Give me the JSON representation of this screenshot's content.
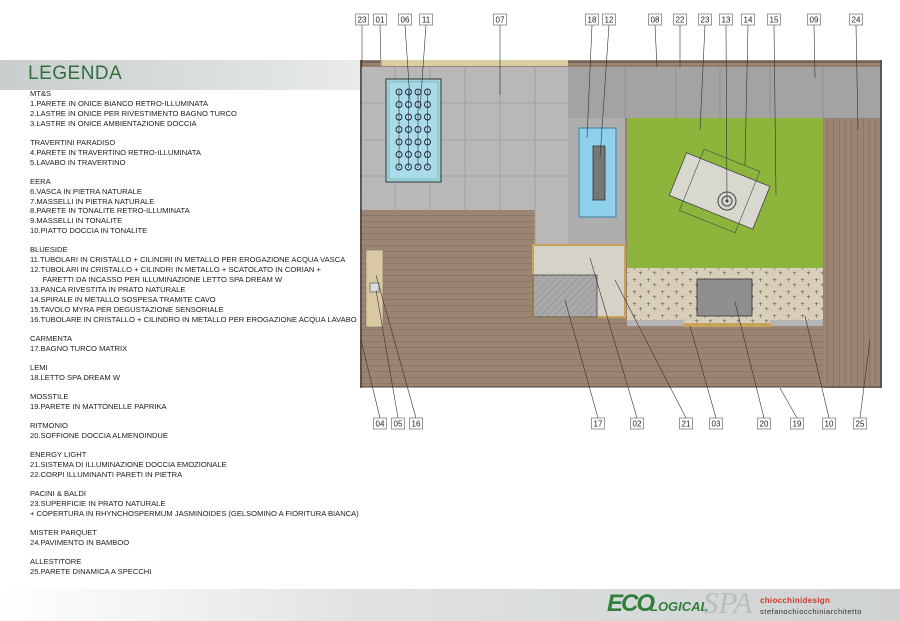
{
  "legend": {
    "title": "LEGENDA",
    "groups": [
      {
        "title": "MT&S",
        "items": [
          "1.PARETE IN ONICE BIANCO RETRO-ILLUMINATA",
          "2.LASTRE IN ONICE PER RIVESTIMENTO BAGNO TURCO",
          "3.LASTRE IN ONICE AMBIENTAZIONE DOCCIA"
        ]
      },
      {
        "title": "TRAVERTINI PARADISO",
        "items": [
          "4.PARETE IN TRAVERTINO RETRO-ILLUMINATA",
          "5.LAVABO IN TRAVERTINO"
        ]
      },
      {
        "title": "EERA",
        "items": [
          "6.VASCA IN PIETRA NATURALE",
          "7.MASSELLI IN PIETRA NATURALE",
          "8.PARETE IN TONALITE RETRO-ILLUMINATA",
          "9.MASSELLI IN TONALITE",
          "10.PIATTO DOCCIA IN TONALITE"
        ]
      },
      {
        "title": "BLUESIDE",
        "items": [
          "11.TUBOLARI IN CRISTALLO + CILINDRI IN METALLO PER EROGAZIONE ACQUA VASCA",
          "12.TUBOLARI IN CRISTALLO + CILINDRI IN METALLO + SCATOLATO IN CORIAN +",
          "      FARETTI DA INCASSO PER ILLUMINAZIONE LETTO SPA DREAM W",
          "13.PANCA RIVESTITA IN PRATO NATURALE",
          "14.SPIRALE IN METALLO SOSPESA TRAMITE CAVO",
          "15.TAVOLO MYRA PER DEGUSTAZIONE SENSORIALE",
          "16.TUBOLARE IN CRISTALLO + CILINDRO IN METALLO PER EROGAZIONE ACQUA LAVABO"
        ]
      },
      {
        "title": "CARMENTA",
        "items": [
          "17.BAGNO TURCO MATRIX"
        ]
      },
      {
        "title": "LEMI",
        "items": [
          "18.LETTO SPA DREAM W"
        ]
      },
      {
        "title": "MOSSTILE",
        "items": [
          "19.PARETE IN MATTONELLE PAPRIKA"
        ]
      },
      {
        "title": "RITMONIO",
        "items": [
          "20.SOFFIONE DOCCIA ALMENOINDUE"
        ]
      },
      {
        "title": "ENERGY LIGHT",
        "items": [
          "21.SISTEMA DI ILLUMINAZIONE DOCCIA EMOZIONALE",
          "22.CORPI ILLUMINANTI PARETI IN PIETRA"
        ]
      },
      {
        "title": "PACINI & BALDI",
        "items": [
          "23.SUPERFICIE IN PRATO NATURALE",
          "+ COPERTURA IN RHYNCHOSPERMUM JASMINOIDES (GELSOMINO A FIORITURA BIANCA)"
        ]
      },
      {
        "title": "MISTER PARQUET",
        "items": [
          "24.PAVIMENTO IN BAMBOO"
        ]
      },
      {
        "title": "ALLESTITORE",
        "items": [
          "25.PARETE DINAMICA A SPECCHI"
        ]
      }
    ]
  },
  "plan": {
    "top_labels": [
      "23",
      "01",
      "06",
      "11",
      "07",
      "18",
      "12",
      "08",
      "22",
      "23",
      "13",
      "14",
      "15",
      "09",
      "24"
    ],
    "bottom_labels": [
      "04",
      "05",
      "16",
      "17",
      "02",
      "21",
      "03",
      "20",
      "19",
      "10",
      "25"
    ],
    "colors": {
      "bamboo": "#9c8472",
      "stone": "#b9b9b9",
      "stone_dark": "#a6a6a6",
      "grass": "#8db33a",
      "water": "#9fd6e6",
      "outline": "#444444"
    }
  },
  "footer": {
    "logo_eco": "ECO",
    "logo_logical": "LOGICAL",
    "logo_spa": "SPA",
    "brand_line1": "chiocchinidesign",
    "brand_line2": "stefanochiocchiniarchitetto"
  }
}
